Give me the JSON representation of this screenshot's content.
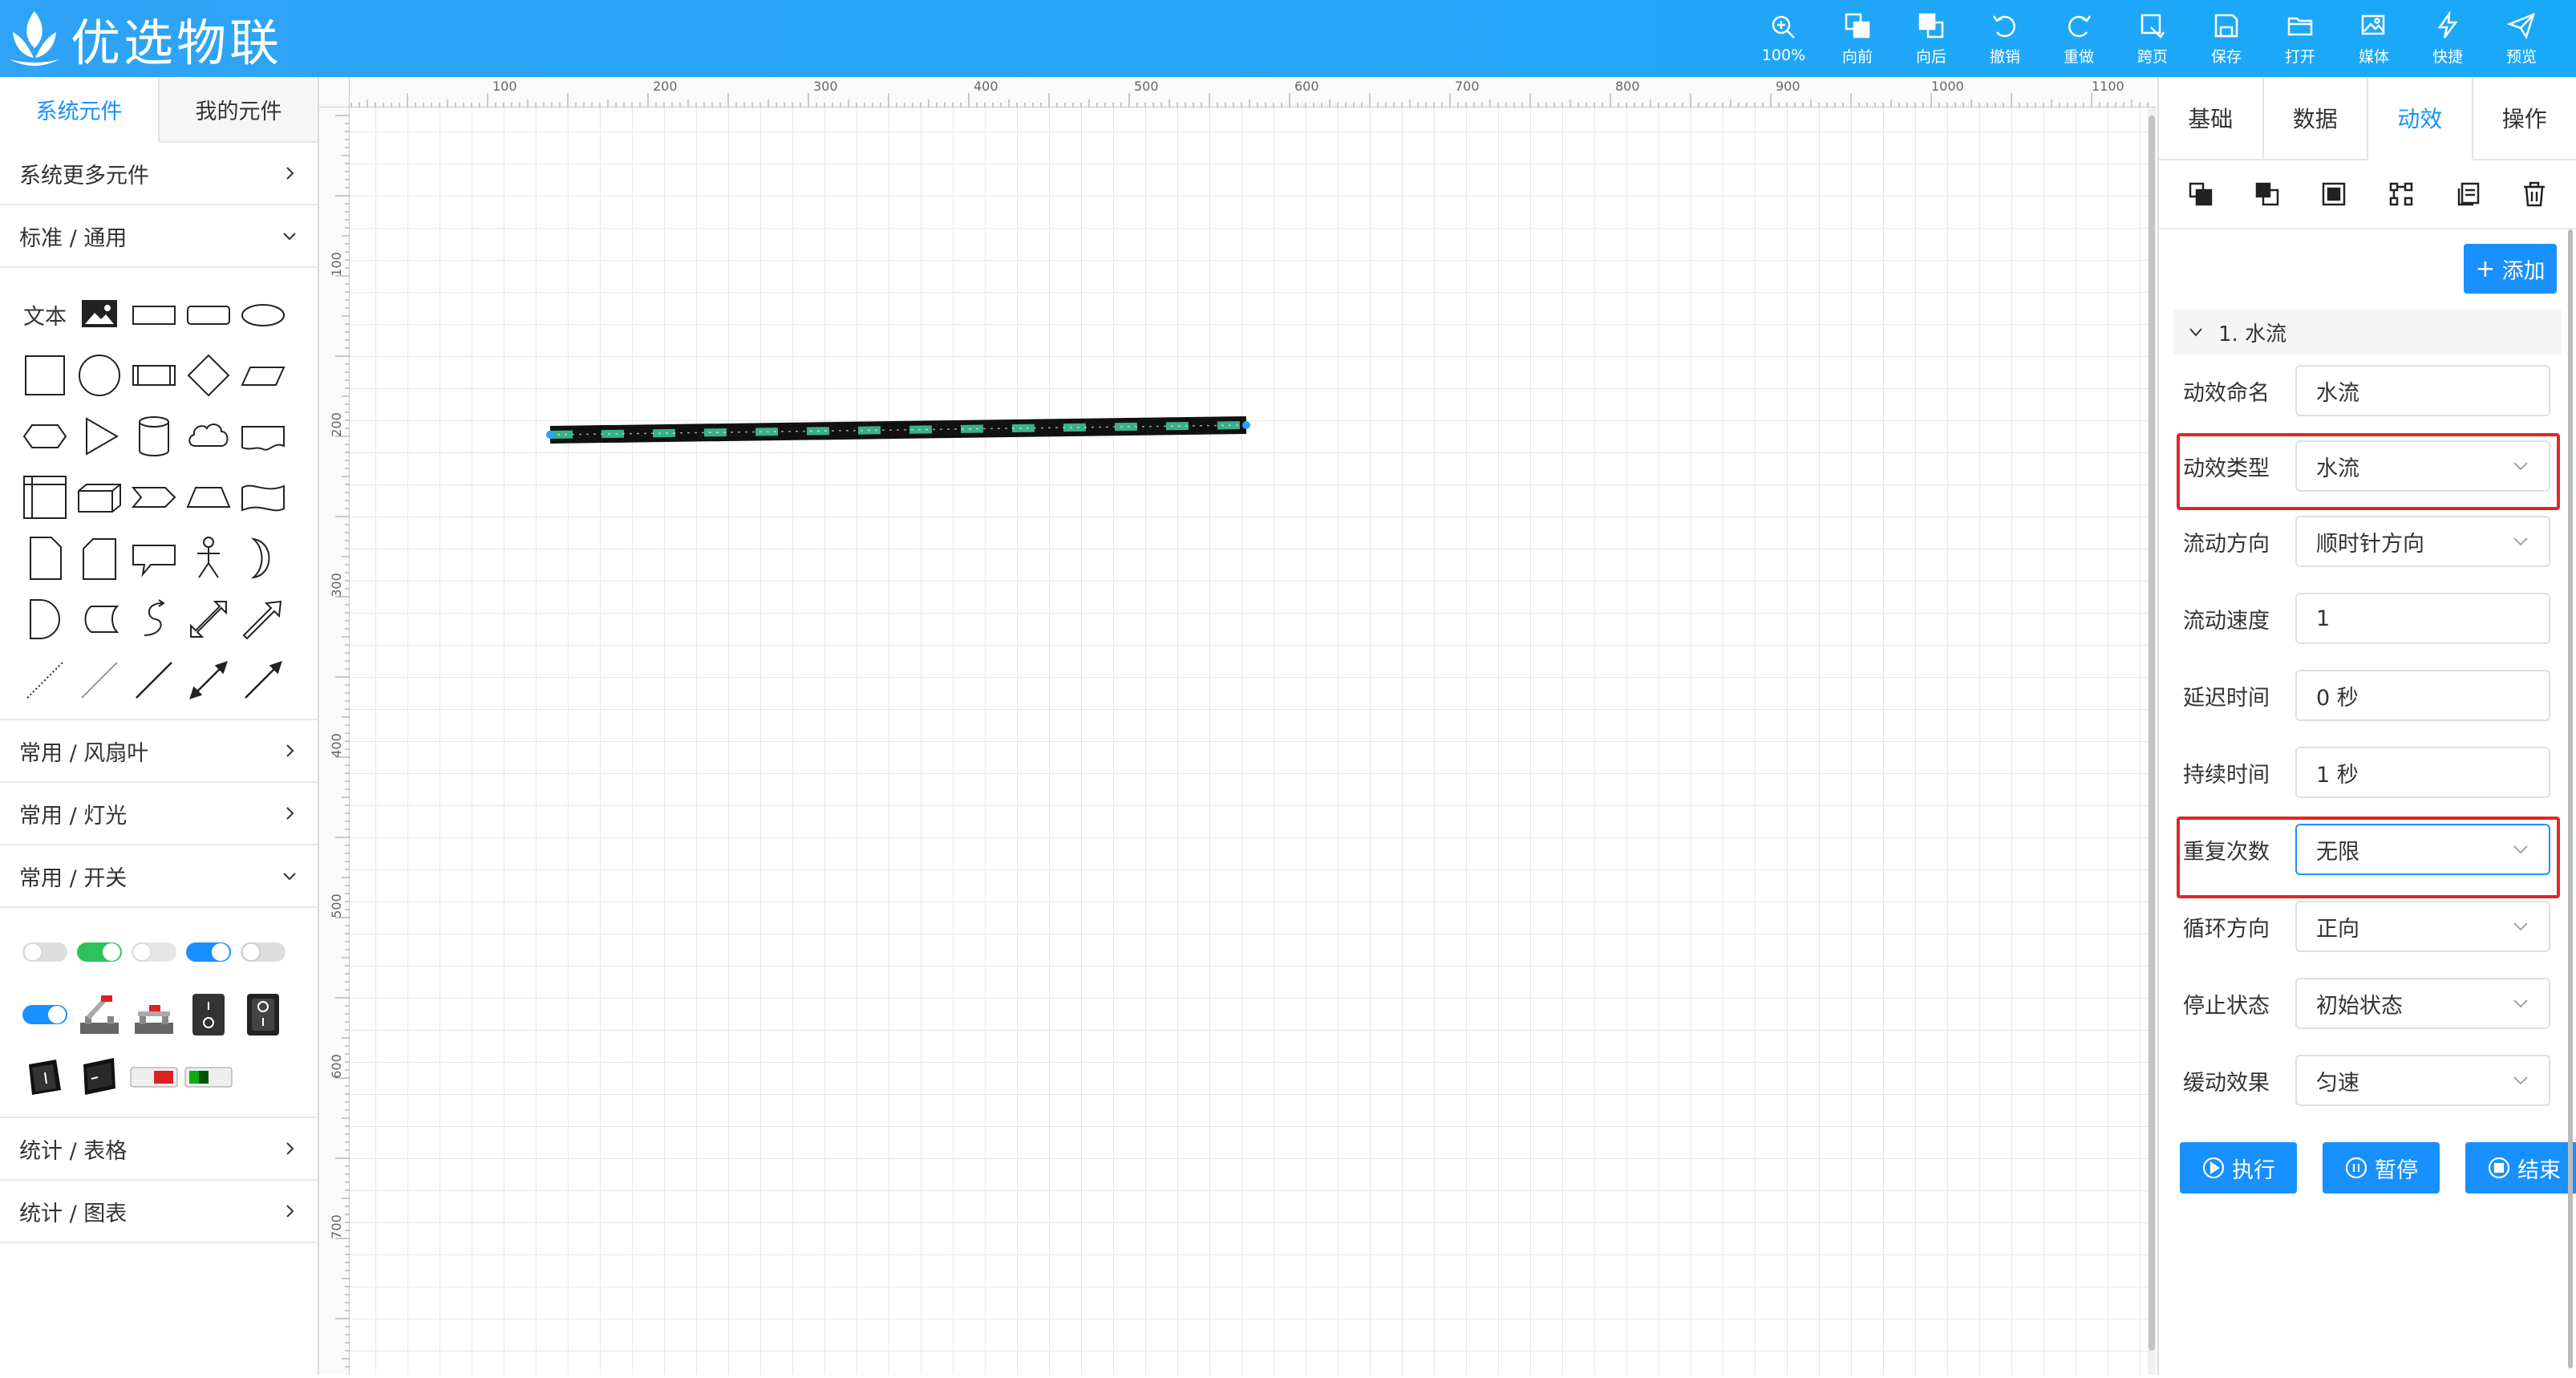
{
  "app": {
    "title": "优选物联"
  },
  "toolbar": [
    {
      "icon": "zoom-in-icon",
      "label": "100%"
    },
    {
      "icon": "bring-forward-icon",
      "label": "向前"
    },
    {
      "icon": "send-backward-icon",
      "label": "向后"
    },
    {
      "icon": "undo-icon",
      "label": "撤销"
    },
    {
      "icon": "redo-icon",
      "label": "重做"
    },
    {
      "icon": "cross-page-icon",
      "label": "跨页"
    },
    {
      "icon": "save-icon",
      "label": "保存"
    },
    {
      "icon": "open-folder-icon",
      "label": "打开"
    },
    {
      "icon": "media-icon",
      "label": "媒体"
    },
    {
      "icon": "lightning-icon",
      "label": "快捷"
    },
    {
      "icon": "send-icon",
      "label": "预览"
    }
  ],
  "left": {
    "tabs": [
      "系统元件",
      "我的元件"
    ],
    "groups": {
      "more": "系统更多元件",
      "standard": "标准 / 通用",
      "fan": "常用 / 风扇叶",
      "light": "常用 / 灯光",
      "switch": "常用 / 开关",
      "table": "统计 / 表格",
      "chart": "统计 / 图表"
    },
    "text_tool": "文本"
  },
  "ruler": {
    "top": [
      "100",
      "200",
      "300",
      "400",
      "500",
      "600",
      "700",
      "800",
      "900",
      "1000",
      "1100"
    ],
    "left": [
      "100",
      "200",
      "300",
      "400",
      "500",
      "600",
      "700"
    ]
  },
  "right": {
    "tabs": [
      "基础",
      "数据",
      "动效",
      "操作"
    ],
    "active_tab": "动效",
    "add_label": "添加",
    "section_title": "1. 水流",
    "fields": [
      {
        "label": "动效命名",
        "value": "水流",
        "type": "input"
      },
      {
        "label": "动效类型",
        "value": "水流",
        "type": "select"
      },
      {
        "label": "流动方向",
        "value": "顺时针方向",
        "type": "select"
      },
      {
        "label": "流动速度",
        "value": "1",
        "type": "input"
      },
      {
        "label": "延迟时间",
        "value": "0 秒",
        "type": "input"
      },
      {
        "label": "持续时间",
        "value": "1 秒",
        "type": "input"
      },
      {
        "label": "重复次数",
        "value": "无限",
        "type": "select"
      },
      {
        "label": "循环方向",
        "value": "正向",
        "type": "select"
      },
      {
        "label": "停止状态",
        "value": "初始状态",
        "type": "select"
      },
      {
        "label": "缓动效果",
        "value": "匀速",
        "type": "select"
      }
    ],
    "actions": [
      "执行",
      "暂停",
      "结束"
    ]
  },
  "colors": {
    "accent": "#1890ff",
    "header": "#2fa3f5",
    "highlight": "#e12626",
    "flow": "#3ab08a"
  }
}
